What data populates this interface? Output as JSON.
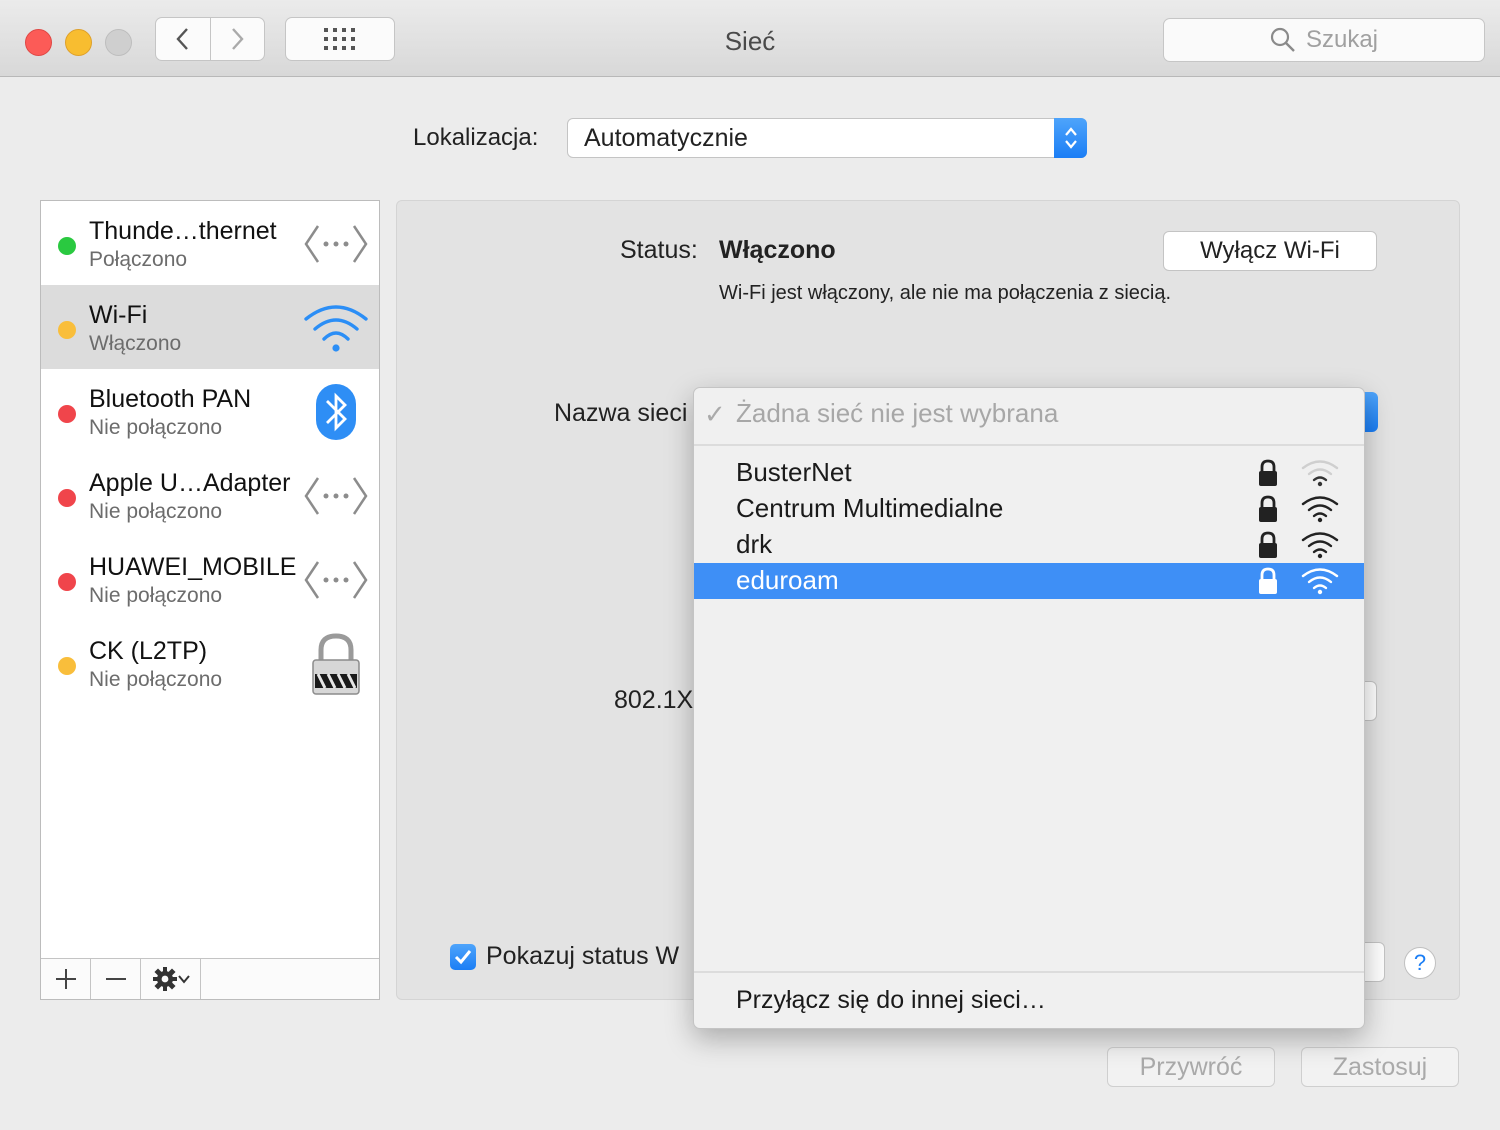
{
  "window": {
    "title": "Sieć"
  },
  "search": {
    "placeholder": "Szukaj"
  },
  "location": {
    "label": "Lokalizacja:",
    "value": "Automatycznie"
  },
  "services": [
    {
      "name": "Thunde…thernet",
      "status": "Połączono",
      "dot_color": "#2ac940",
      "icon": "ethernet-icon"
    },
    {
      "name": "Wi-Fi",
      "status": "Włączono",
      "dot_color": "#f9be3b",
      "icon": "wifi-icon"
    },
    {
      "name": "Bluetooth PAN",
      "status": "Nie połączono",
      "dot_color": "#f0454b",
      "icon": "bluetooth-icon"
    },
    {
      "name": "Apple U…Adapter",
      "status": "Nie połączono",
      "dot_color": "#f0454b",
      "icon": "ethernet-icon"
    },
    {
      "name": "HUAWEI_MOBILE",
      "status": "Nie połączono",
      "dot_color": "#f0454b",
      "icon": "ethernet-icon"
    },
    {
      "name": "CK (L2TP)",
      "status": "Nie połączono",
      "dot_color": "#f9be3b",
      "icon": "vpn-lock-icon"
    }
  ],
  "status": {
    "label": "Status:",
    "value": "Włączono",
    "description": "Wi-Fi jest włączony, ale nie ma połączenia z siecią.",
    "toggle_button": "Wyłącz Wi-Fi"
  },
  "network_name": {
    "label": "Nazwa sieci"
  },
  "auth": {
    "label": "802.1X"
  },
  "show_status": {
    "label": "Pokazuj status W",
    "checked": true
  },
  "dropdown": {
    "none_option": "Żadna sieć nie jest wybrana",
    "networks": [
      {
        "name": "BusterNet",
        "locked": true,
        "signal": "weak"
      },
      {
        "name": "Centrum Multimedialne",
        "locked": true,
        "signal": "strong"
      },
      {
        "name": "drk",
        "locked": true,
        "signal": "strong"
      },
      {
        "name": "eduroam",
        "locked": true,
        "signal": "strong",
        "highlighted": true
      }
    ],
    "join_other": "Przyłącz się do innej sieci…"
  },
  "footer": {
    "restore": "Przywróć",
    "apply": "Zastosuj"
  },
  "colors": {
    "accent": "#1b7ef5",
    "highlight": "#3e8ff6"
  }
}
